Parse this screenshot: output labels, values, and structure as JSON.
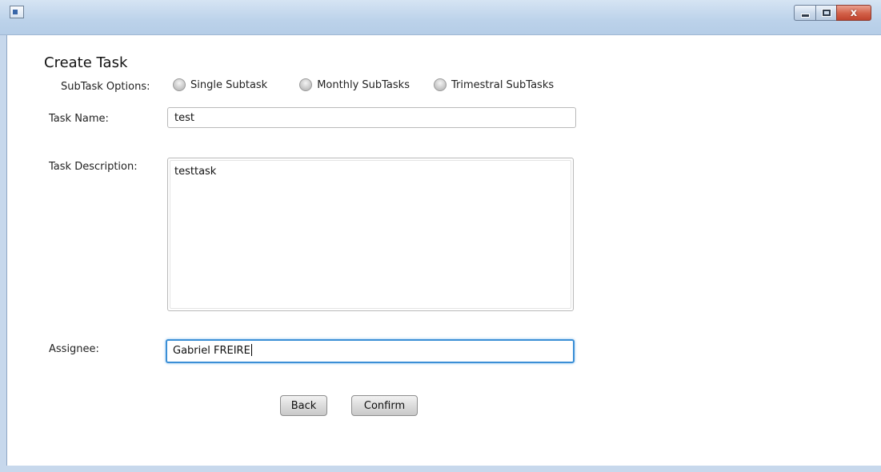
{
  "window": {
    "title": "",
    "controls": {
      "minimize_icon": "minimize-icon",
      "maximize_icon": "maximize-icon",
      "close_icon": "close-icon",
      "close_glyph": "x"
    }
  },
  "form": {
    "title": "Create Task",
    "subtask": {
      "label": "SubTask Options:",
      "options": [
        {
          "label": "Single Subtask",
          "selected": false
        },
        {
          "label": "Monthly SubTasks",
          "selected": false
        },
        {
          "label": "Trimestral SubTasks",
          "selected": false
        }
      ]
    },
    "task_name": {
      "label": "Task Name:",
      "value": "test"
    },
    "task_description": {
      "label": "Task Description:",
      "value": "testtask"
    },
    "assignee": {
      "label": "Assignee:",
      "value": "Gabriel FREIRE"
    },
    "buttons": {
      "back": "Back",
      "confirm": "Confirm"
    }
  },
  "colors": {
    "focus_border": "#3b8fd6",
    "titlebar": "#c7d8ec",
    "close_button": "#c0432d"
  }
}
